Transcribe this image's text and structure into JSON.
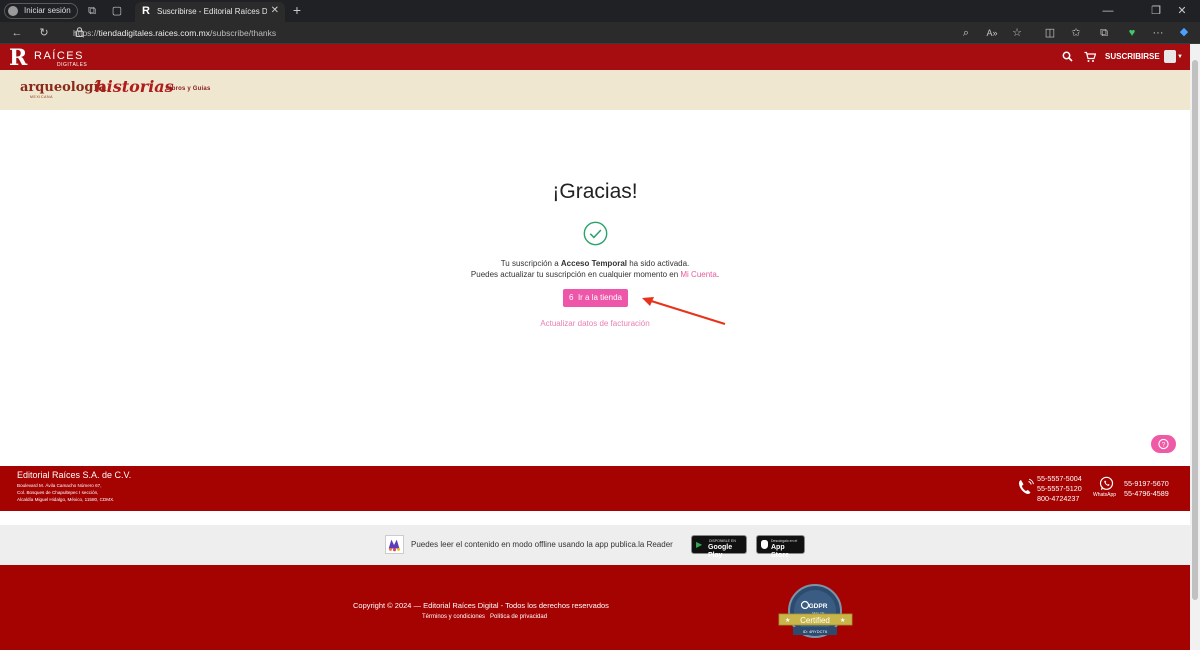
{
  "browser": {
    "signin_label": "Iniciar sesión",
    "tab_title": "Suscribirse - Editorial Raíces Digi",
    "tab_favicon": "R",
    "url_scheme": "https://",
    "url_host": "tiendadigitales.raices.com.mx",
    "url_path": "/subscribe/thanks"
  },
  "header": {
    "logo_letter": "R",
    "logo_text": "RAÍCES",
    "logo_sub": "DIGITALES",
    "subscribe_label": "SUSCRIBIRSE",
    "accent_color": "#a50d10"
  },
  "subnav": {
    "brand_arqueologia": "arqueología",
    "brand_arqueologia_sub": "MEXICANA",
    "brand_historias": "historias",
    "brand_guias": "Libros y Guías",
    "background": "#efe7cf"
  },
  "main": {
    "title": "¡Gracias!",
    "msg1_pre": "Tu suscripción a ",
    "msg1_bold": "Acceso Temporal",
    "msg1_post": " ha sido activada.",
    "msg2_pre": "Puedes actualizar tu suscripción en cualquier momento en ",
    "msg2_link": "Mi Cuenta",
    "msg2_post": ".",
    "store_button_count": "6",
    "store_button_label": "Ir a la tienda",
    "billing_link": "Actualizar datos de facturación",
    "button_color": "#ee57a9",
    "success_color": "#27a36b"
  },
  "footer": {
    "company_name": "Editorial Raíces S.A. de C.V.",
    "address": [
      "Boulevard M. Ávila Camacho Número 67,",
      "Col. Bosques de Chapultepec I sección,",
      "Alcaldía Miguel Hidalgo, México, 11580, CDMX."
    ],
    "phones": [
      "55-5557-5004",
      "55-5557-5120",
      "800-4724237"
    ],
    "whatsapp_label": "WhatsApp",
    "whatsapp_numbers": [
      "55-9197-5670",
      "55-4796-4589"
    ],
    "app_text": "Puedes leer el contenido en modo offline usando la app publica.la Reader",
    "google_play_small": "DISPONIBLE EN",
    "google_play_big": "Google Play",
    "app_store_small": "Descárgalo en el",
    "app_store_big": "App Store",
    "copyright": "Copyright © 2024 — Editorial Raíces Digital - Todos los derechos reservados",
    "terms": "Términos y condiciones",
    "privacy": "Política de privacidad",
    "gdpr_title": "GDPR",
    "gdpr_sub": "SEAL OF",
    "gdpr_certified": "Certified",
    "gdpr_id": "ID: 4RYDCT6"
  }
}
